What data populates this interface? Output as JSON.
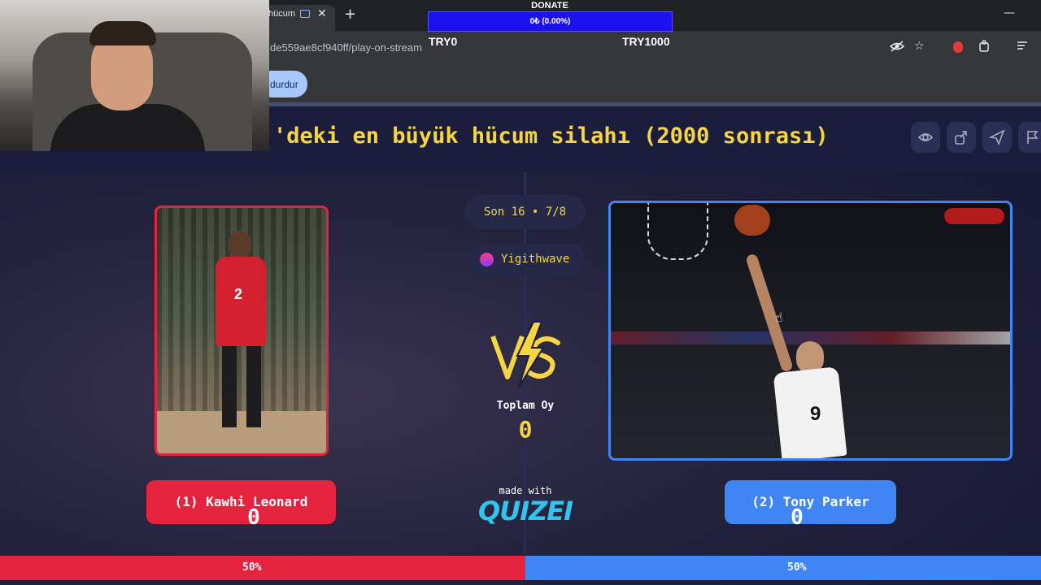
{
  "browser": {
    "tab_title": "hücum",
    "tab_close": "✕",
    "new_tab": "+",
    "window_minimize": "—",
    "url": "de559ae8cf940ff/play-on-stream",
    "bookmark_pill": "durdur",
    "addr_icons": [
      "eye-off-icon",
      "star-icon",
      "extension-icon",
      "puzzle-icon",
      "menu-icon"
    ]
  },
  "donate": {
    "label": "DONATE",
    "progress_text": "0₺ (0.00%)",
    "progress": 0,
    "min": "TRY0",
    "max": "TRY1000"
  },
  "page": {
    "title": "'deki en büyük hücum silahı (2000 sonrası)",
    "actions": [
      "eye-icon",
      "share-icon",
      "send-icon",
      "flag-icon"
    ],
    "round": "Son 16 • 7/8",
    "user": "Yigithwave",
    "total_votes_label": "Toplam Oy",
    "total_votes": "0",
    "made_with": "made with",
    "logo": "QUIZEI"
  },
  "players": {
    "left": {
      "name": "(1) Kawhi Leonard",
      "votes": "0",
      "percent": "50%",
      "jersey_number": "2",
      "color": "#e5233f"
    },
    "right": {
      "name": "(2) Tony Parker",
      "votes": "0",
      "percent": "50%",
      "jersey_number": "9",
      "color": "#3f86f4"
    }
  },
  "colors": {
    "accent_yellow": "#f7d542",
    "red": "#e5233f",
    "blue": "#3f86f4",
    "logo_cyan": "#2fc5ee"
  }
}
